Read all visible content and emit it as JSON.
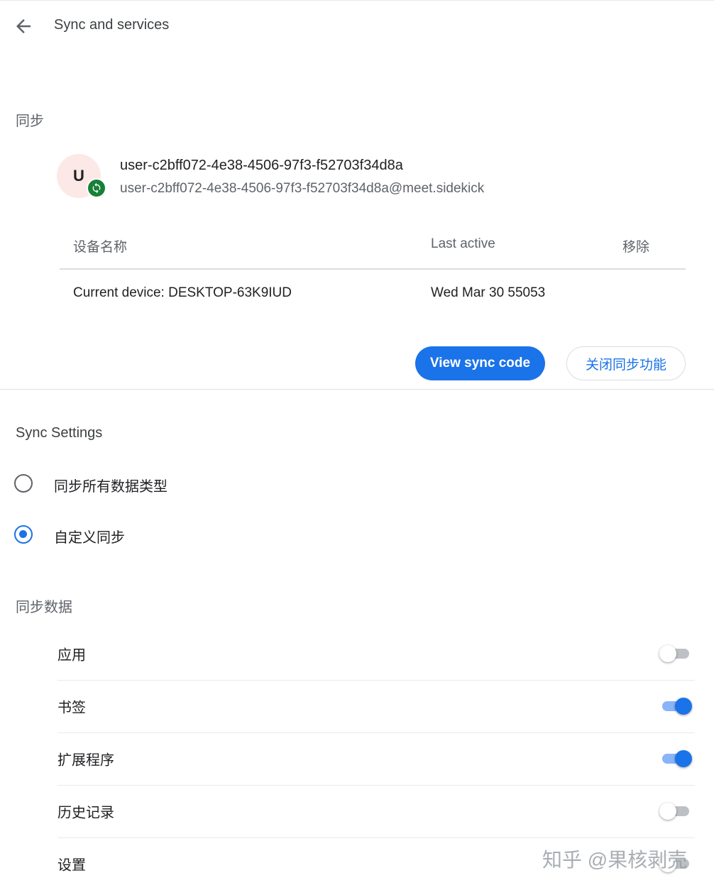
{
  "header": {
    "title": "Sync and services"
  },
  "sync_section": {
    "label": "同步",
    "account": {
      "avatar_letter": "U",
      "name": "user-c2bff072-4e38-4506-97f3-f52703f34d8a",
      "email": "user-c2bff072-4e38-4506-97f3-f52703f34d8a@meet.sidekick",
      "badge_color": "#188038"
    },
    "devices": {
      "columns": [
        "设备名称",
        "Last active",
        "移除"
      ],
      "rows": [
        {
          "name": "Current device: DESKTOP-63K9IUD",
          "last_active": "Wed Mar 30 55053"
        }
      ]
    },
    "buttons": {
      "view_sync_code": "View sync code",
      "turn_off_sync": "关闭同步功能"
    }
  },
  "sync_settings": {
    "label": "Sync Settings",
    "options": [
      {
        "label": "同步所有数据类型",
        "selected": false
      },
      {
        "label": "自定义同步",
        "selected": true
      }
    ]
  },
  "sync_data": {
    "label": "同步数据",
    "items": [
      {
        "label": "应用",
        "enabled": false
      },
      {
        "label": "书签",
        "enabled": true
      },
      {
        "label": "扩展程序",
        "enabled": true
      },
      {
        "label": "历史记录",
        "enabled": false
      },
      {
        "label": "设置",
        "enabled": false
      }
    ]
  },
  "watermark": "知乎 @果核剥壳",
  "colors": {
    "accent": "#1a73e8",
    "badge": "#188038"
  }
}
